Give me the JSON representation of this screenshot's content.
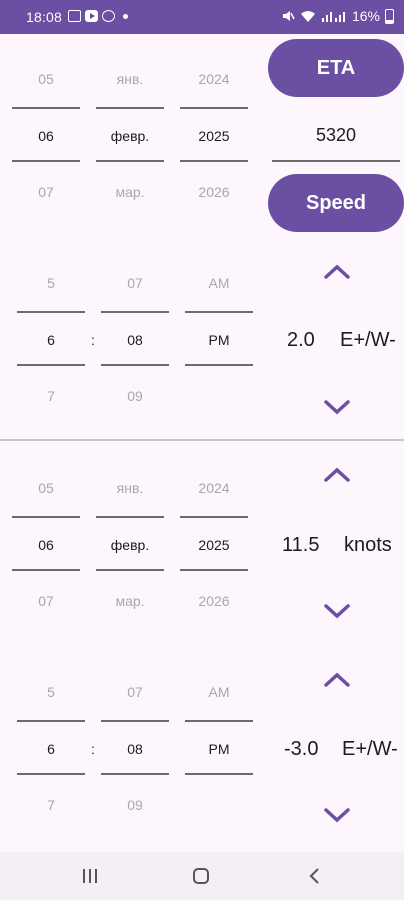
{
  "status_bar": {
    "time": "18:08",
    "battery": "16%"
  },
  "colors": {
    "accent": "#6a4fa3",
    "background": "#fdf7fd"
  },
  "date_picker_1": {
    "day": [
      "05",
      "06",
      "07"
    ],
    "month": [
      "янв.",
      "февр.",
      "мар."
    ],
    "year": [
      "2024",
      "2025",
      "2026"
    ]
  },
  "time_picker_1": {
    "hour": [
      "5",
      "6",
      "7"
    ],
    "minute": [
      "07",
      "08",
      "09"
    ],
    "ampm": [
      "AM",
      "PM",
      ""
    ],
    "separator": ":"
  },
  "date_picker_2": {
    "day": [
      "05",
      "06",
      "07"
    ],
    "month": [
      "янв.",
      "февр.",
      "мар."
    ],
    "year": [
      "2024",
      "2025",
      "2026"
    ]
  },
  "time_picker_2": {
    "hour": [
      "5",
      "6",
      "7"
    ],
    "minute": [
      "07",
      "08",
      "09"
    ],
    "ampm": [
      "AM",
      "PM",
      ""
    ],
    "separator": ":"
  },
  "eta_button": {
    "label": "ETA"
  },
  "eta_value": "5320",
  "speed_button": {
    "label": "Speed"
  },
  "stepper_1": {
    "value": "2.0",
    "unit": "E+/W-"
  },
  "stepper_2": {
    "value": "11.5",
    "unit": "knots"
  },
  "stepper_3": {
    "value": "-3.0",
    "unit": "E+/W-"
  }
}
